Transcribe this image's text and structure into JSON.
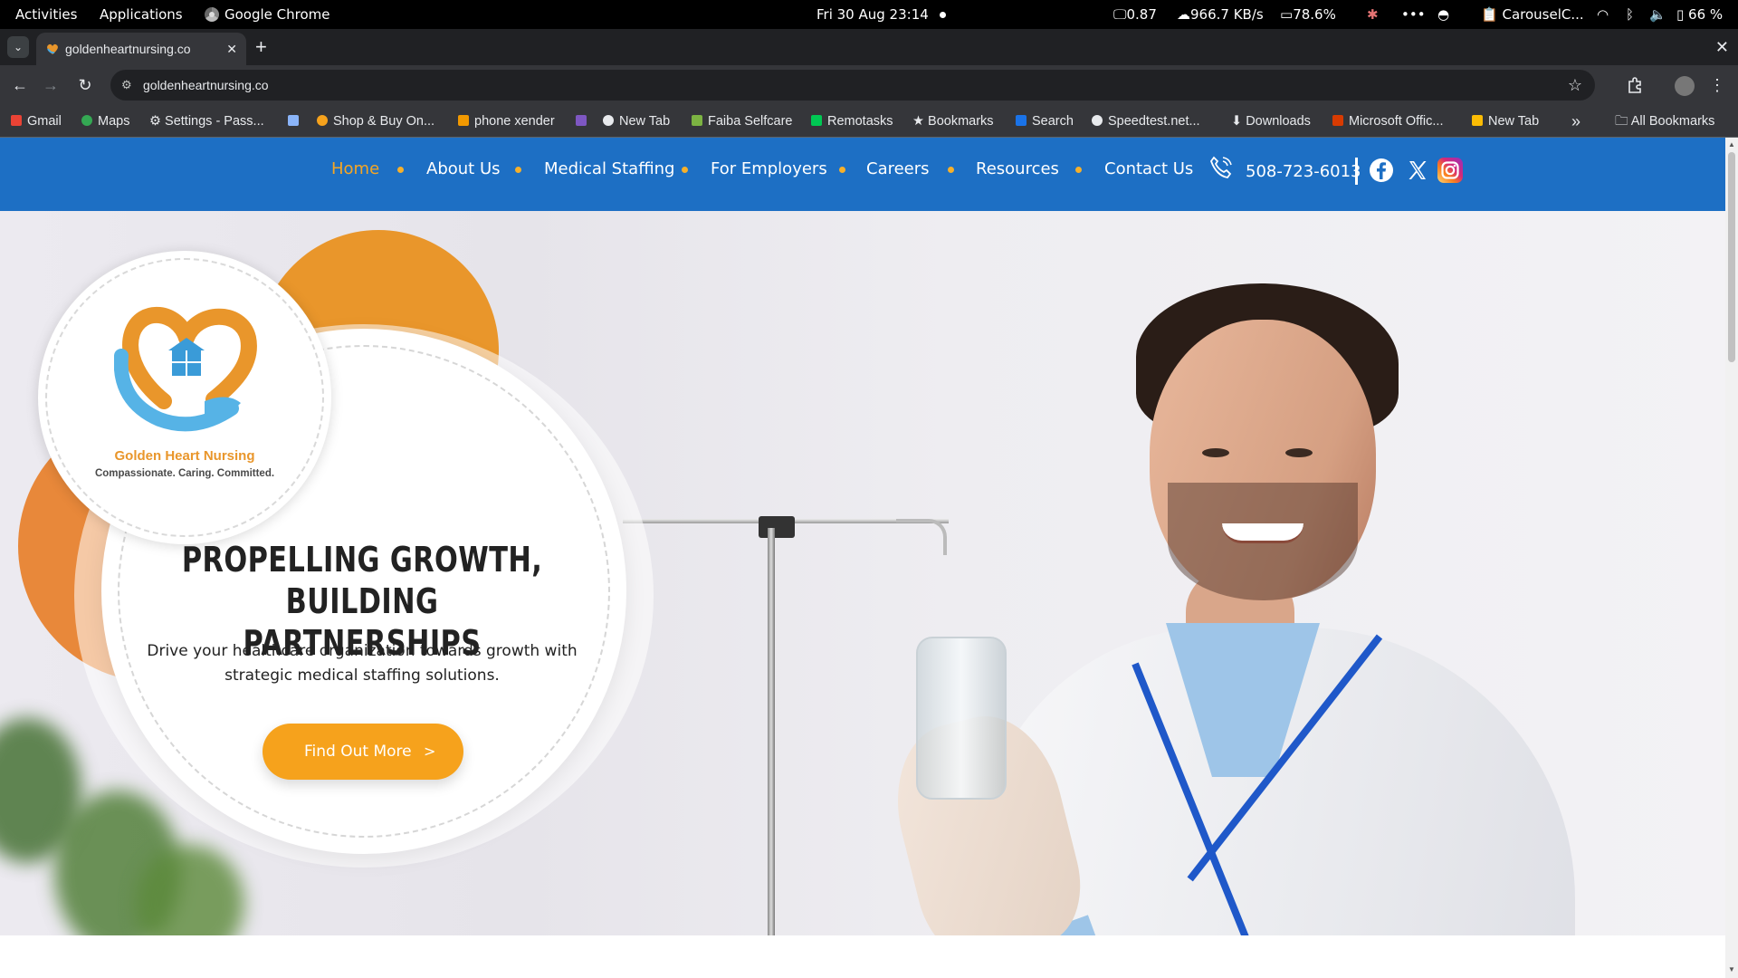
{
  "system_bar": {
    "activities": "Activities",
    "applications": "Applications",
    "app_name": "Google Chrome",
    "datetime": "Fri 30 Aug  23:14",
    "load": "0.87",
    "network": "966.7 KB/s",
    "memory": "78.6%",
    "more": "•••",
    "clipboard": "CarouselC...",
    "battery": "66 %"
  },
  "browser": {
    "tab_title": "goldenheartnursing.co",
    "tab_close": "✕",
    "new_tab": "+",
    "window_close": "✕",
    "url": "goldenheartnursing.co",
    "bookmarks": [
      {
        "label": "Gmail",
        "color": "#ea4335"
      },
      {
        "label": "Maps",
        "color": "#34a853"
      },
      {
        "label": "Settings - Pass...",
        "color": "#e8eaed"
      },
      {
        "label": "",
        "color": "#8ab4f8"
      },
      {
        "label": "Shop & Buy On...",
        "color": "#f6a21c"
      },
      {
        "label": "phone xender",
        "color": "#f29900"
      },
      {
        "label": "",
        "color": "#7e57c2"
      },
      {
        "label": "New Tab",
        "color": "#e8eaed"
      },
      {
        "label": "Faiba Selfcare",
        "color": "#7cb342"
      },
      {
        "label": "Remotasks",
        "color": "#00c853"
      },
      {
        "label": "Bookmarks",
        "color": "#e8eaed"
      },
      {
        "label": "Search",
        "color": "#1a73e8"
      },
      {
        "label": "Speedtest.net...",
        "color": "#e8eaed"
      },
      {
        "label": "Downloads",
        "color": "#e8eaed"
      },
      {
        "label": "Microsoft Offic...",
        "color": "#d83b01"
      },
      {
        "label": "New Tab",
        "color": "#fbbc04"
      }
    ],
    "bookmarks_overflow": "»",
    "all_bookmarks": "All Bookmarks"
  },
  "site": {
    "nav": [
      "Home",
      "About Us",
      "Medical Staffing",
      "For Employers",
      "Careers",
      "Resources",
      "Contact Us"
    ],
    "active_nav": "Home",
    "phone": "508-723-6013",
    "social": [
      "facebook-icon",
      "x-icon",
      "instagram-icon"
    ],
    "logo_name": "Golden Heart Nursing",
    "logo_tagline": "Compassionate. Caring. Committed.",
    "hero_title": "PROPELLING GROWTH, BUILDING PARTNERSHIPS",
    "hero_subtitle": "Drive your healthcare organization towards growth with strategic medical staffing solutions.",
    "cta_label": "Find Out More",
    "cta_arrow": ">",
    "colors": {
      "nav_bg": "#1d6fc4",
      "accent": "#f6a21c",
      "active_link": "#f6a623"
    }
  }
}
